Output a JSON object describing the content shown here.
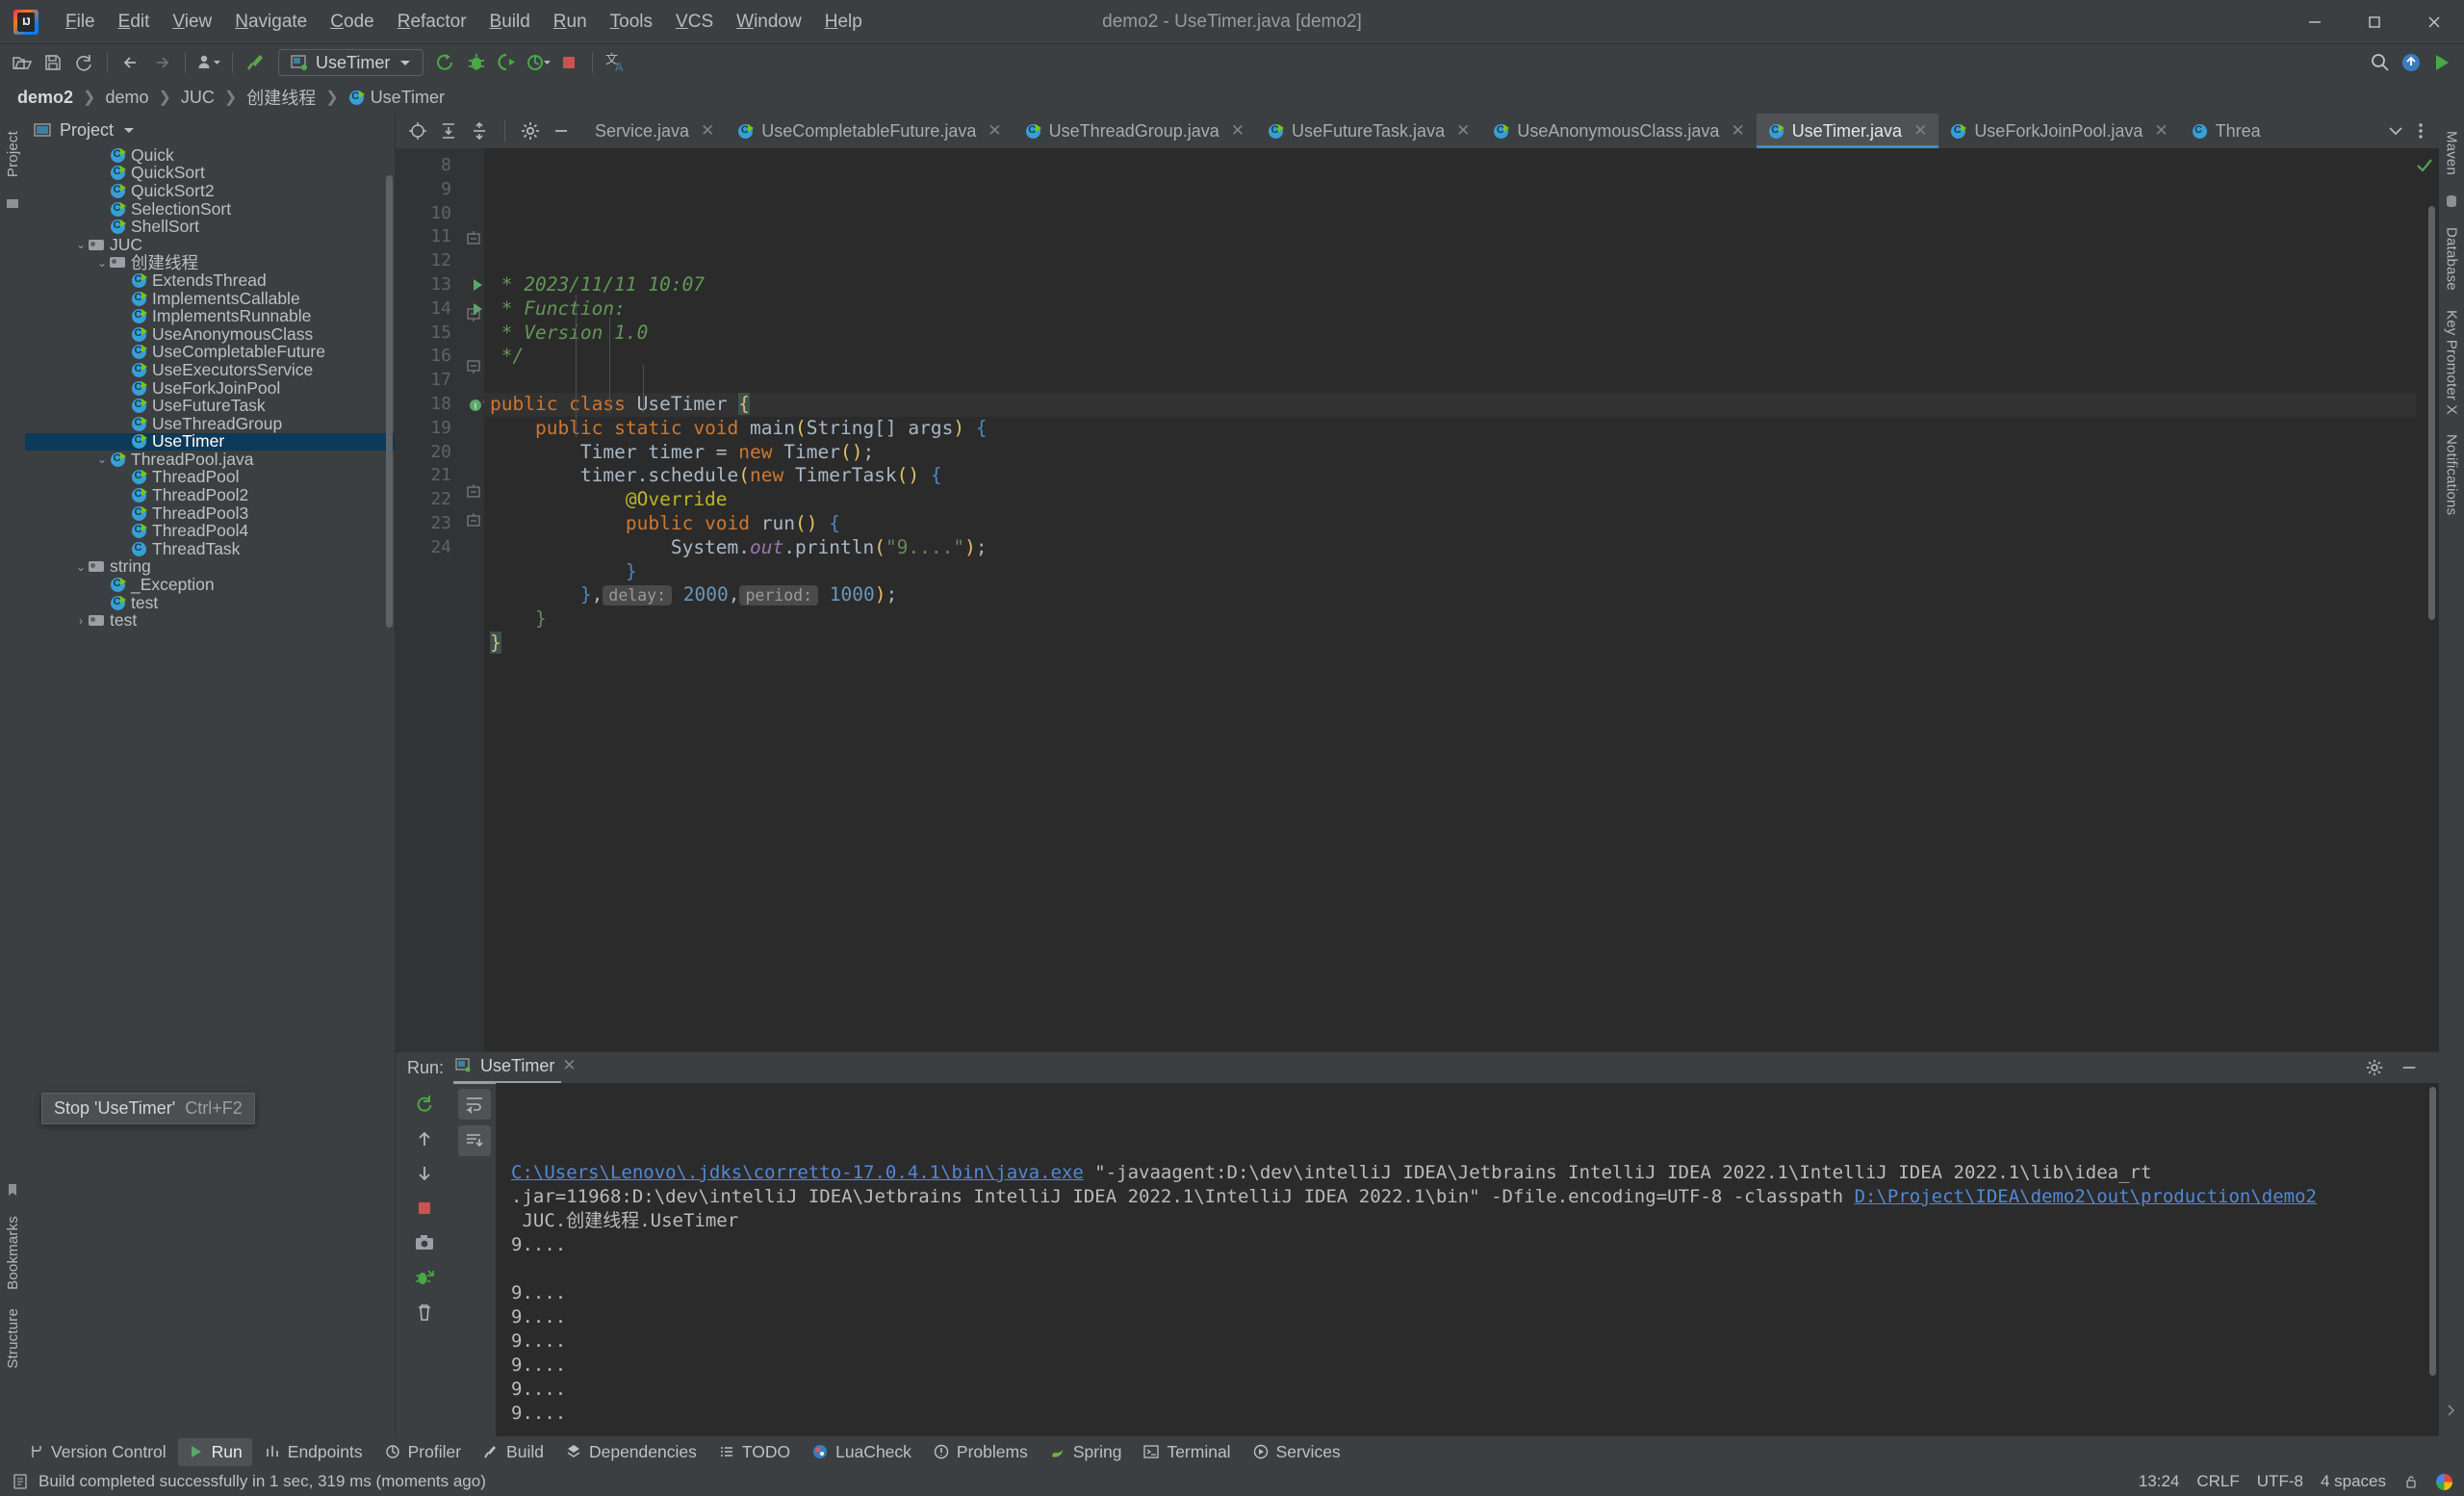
{
  "window": {
    "title": "demo2 - UseTimer.java [demo2]",
    "minimize": "—",
    "maximize": "▢",
    "close": "✕"
  },
  "menu": [
    "File",
    "Edit",
    "View",
    "Navigate",
    "Code",
    "Refactor",
    "Build",
    "Run",
    "Tools",
    "VCS",
    "Window",
    "Help"
  ],
  "toolbar": {
    "run_config": "UseTimer",
    "icons": [
      "open-folder-icon",
      "save-icon",
      "sync-icon",
      "back-arrow-icon",
      "forward-arrow-icon",
      "profile-icon",
      "build-hammer-icon",
      "run-icon",
      "debug-icon",
      "run-with-coverage-icon",
      "profile-run-icon",
      "stop-icon",
      "translate-icon",
      "search-everywhere-icon",
      "updates-icon",
      "ide-run-icon"
    ]
  },
  "breadcrumb": [
    "demo2",
    "demo",
    "JUC",
    "创建线程",
    "UseTimer"
  ],
  "left_strip": [
    "Project",
    "Bookmarks",
    "Structure"
  ],
  "right_strip": [
    "Maven",
    "Database",
    "Key Promoter X",
    "Notifications"
  ],
  "project": {
    "title": "Project",
    "tree": [
      {
        "label": "Quick",
        "indent": 3,
        "icon": "class-icon",
        "arrow": "",
        "selected": false
      },
      {
        "label": "QuickSort",
        "indent": 3,
        "icon": "class-icon",
        "arrow": "",
        "selected": false
      },
      {
        "label": "QuickSort2",
        "indent": 3,
        "icon": "class-icon",
        "arrow": "",
        "selected": false
      },
      {
        "label": "SelectionSort",
        "indent": 3,
        "icon": "class-icon",
        "arrow": "",
        "selected": false
      },
      {
        "label": "ShellSort",
        "indent": 3,
        "icon": "class-icon",
        "arrow": "",
        "selected": false
      },
      {
        "label": "JUC",
        "indent": 2,
        "icon": "folder-icon",
        "arrow": "v",
        "selected": false
      },
      {
        "label": "创建线程",
        "indent": 3,
        "icon": "folder-icon",
        "arrow": "v",
        "selected": false
      },
      {
        "label": "ExtendsThread",
        "indent": 4,
        "icon": "class-icon",
        "arrow": "",
        "selected": false
      },
      {
        "label": "ImplementsCallable",
        "indent": 4,
        "icon": "class-icon",
        "arrow": "",
        "selected": false
      },
      {
        "label": "ImplementsRunnable",
        "indent": 4,
        "icon": "class-icon",
        "arrow": "",
        "selected": false
      },
      {
        "label": "UseAnonymousClass",
        "indent": 4,
        "icon": "class-icon",
        "arrow": "",
        "selected": false
      },
      {
        "label": "UseCompletableFuture",
        "indent": 4,
        "icon": "class-icon",
        "arrow": "",
        "selected": false
      },
      {
        "label": "UseExecutorsService",
        "indent": 4,
        "icon": "class-icon",
        "arrow": "",
        "selected": false
      },
      {
        "label": "UseForkJoinPool",
        "indent": 4,
        "icon": "class-icon",
        "arrow": "",
        "selected": false
      },
      {
        "label": "UseFutureTask",
        "indent": 4,
        "icon": "class-icon",
        "arrow": "",
        "selected": false
      },
      {
        "label": "UseThreadGroup",
        "indent": 4,
        "icon": "class-icon",
        "arrow": "",
        "selected": false
      },
      {
        "label": "UseTimer",
        "indent": 4,
        "icon": "class-icon",
        "arrow": "",
        "selected": true
      },
      {
        "label": "ThreadPool.java",
        "indent": 3,
        "icon": "class-icon",
        "arrow": "v",
        "selected": false
      },
      {
        "label": "ThreadPool",
        "indent": 4,
        "icon": "class-icon",
        "arrow": "",
        "selected": false
      },
      {
        "label": "ThreadPool2",
        "indent": 4,
        "icon": "class-icon",
        "arrow": "",
        "selected": false
      },
      {
        "label": "ThreadPool3",
        "indent": 4,
        "icon": "class-icon",
        "arrow": "",
        "selected": false
      },
      {
        "label": "ThreadPool4",
        "indent": 4,
        "icon": "class-icon",
        "arrow": "",
        "selected": false
      },
      {
        "label": "ThreadTask",
        "indent": 4,
        "icon": "class-plain-icon",
        "arrow": "",
        "selected": false
      },
      {
        "label": "string",
        "indent": 2,
        "icon": "folder-icon",
        "arrow": "v",
        "selected": false
      },
      {
        "label": "_Exception",
        "indent": 3,
        "icon": "class-icon",
        "arrow": "",
        "selected": false
      },
      {
        "label": "test",
        "indent": 3,
        "icon": "class-icon",
        "arrow": "",
        "selected": false
      },
      {
        "label": "test",
        "indent": 2,
        "icon": "folder-icon",
        "arrow": ">",
        "selected": false
      }
    ]
  },
  "editor": {
    "tabs": [
      {
        "label": "Service.java",
        "icon": "",
        "active": false,
        "truncated": true
      },
      {
        "label": "UseCompletableFuture.java",
        "icon": "class-icon",
        "active": false
      },
      {
        "label": "UseThreadGroup.java",
        "icon": "class-icon",
        "active": false
      },
      {
        "label": "UseFutureTask.java",
        "icon": "class-icon",
        "active": false
      },
      {
        "label": "UseAnonymousClass.java",
        "icon": "class-icon",
        "active": false
      },
      {
        "label": "UseTimer.java",
        "icon": "class-icon",
        "active": true
      },
      {
        "label": "UseForkJoinPool.java",
        "icon": "class-icon",
        "active": false
      },
      {
        "label": "Threa",
        "icon": "class-plain-icon",
        "active": false
      }
    ],
    "first_line_number": 8,
    "lines": [
      {
        "n": 8,
        "segments": [
          {
            "t": " * 2023/11/11 10:07",
            "c": "cmt"
          }
        ]
      },
      {
        "n": 9,
        "segments": [
          {
            "t": " * Function:",
            "c": "cmt"
          }
        ]
      },
      {
        "n": 10,
        "segments": [
          {
            "t": " * Version 1.0",
            "c": "cmt"
          }
        ]
      },
      {
        "n": 11,
        "segments": [
          {
            "t": " */",
            "c": "cmt"
          }
        ],
        "fold": "end"
      },
      {
        "n": 12,
        "segments": []
      },
      {
        "n": 13,
        "segments": [
          {
            "t": "public class ",
            "c": "kw"
          },
          {
            "t": "UseTimer ",
            "c": "typ"
          },
          {
            "t": "{",
            "c": "caret"
          }
        ],
        "gutter": "run",
        "current": true
      },
      {
        "n": 14,
        "segments": [
          {
            "t": "    ",
            "c": "plain"
          },
          {
            "t": "public static void ",
            "c": "kw"
          },
          {
            "t": "main",
            "c": "typ"
          },
          {
            "t": "(",
            "c": "brk"
          },
          {
            "t": "String[] args",
            "c": "plain"
          },
          {
            "t": ")",
            "c": "brk"
          },
          {
            "t": " {",
            "c": "brk2"
          }
        ],
        "gutter": "run",
        "fold": "start"
      },
      {
        "n": 15,
        "segments": [
          {
            "t": "        Timer timer = ",
            "c": "plain"
          },
          {
            "t": "new ",
            "c": "kw"
          },
          {
            "t": "Timer",
            "c": "plain"
          },
          {
            "t": "()",
            "c": "brk"
          },
          {
            "t": ";",
            "c": "plain"
          }
        ]
      },
      {
        "n": 16,
        "segments": [
          {
            "t": "        timer.schedule",
            "c": "plain"
          },
          {
            "t": "(",
            "c": "brk"
          },
          {
            "t": "new ",
            "c": "kw"
          },
          {
            "t": "TimerTask",
            "c": "plain"
          },
          {
            "t": "()",
            "c": "brk"
          },
          {
            "t": " {",
            "c": "brk2"
          }
        ],
        "fold": "start"
      },
      {
        "n": 17,
        "segments": [
          {
            "t": "            @Override",
            "c": "ann"
          }
        ]
      },
      {
        "n": 18,
        "segments": [
          {
            "t": "            ",
            "c": "plain"
          },
          {
            "t": "public void ",
            "c": "kw"
          },
          {
            "t": "run",
            "c": "typ"
          },
          {
            "t": "()",
            "c": "brk"
          },
          {
            "t": " {",
            "c": "brk2"
          }
        ],
        "gutter": "override"
      },
      {
        "n": 19,
        "segments": [
          {
            "t": "                System.",
            "c": "plain"
          },
          {
            "t": "out",
            "c": "fld"
          },
          {
            "t": ".println",
            "c": "plain"
          },
          {
            "t": "(",
            "c": "brk"
          },
          {
            "t": "\"9....\"",
            "c": "str"
          },
          {
            "t": ")",
            "c": "brk"
          },
          {
            "t": ";",
            "c": "plain"
          }
        ]
      },
      {
        "n": 20,
        "segments": [
          {
            "t": "            }",
            "c": "brk2"
          }
        ]
      },
      {
        "n": 21,
        "segments": [
          {
            "t": "        }",
            "c": "brk2"
          },
          {
            "t": ",",
            "c": "plain"
          },
          {
            "t": "HINT:delay:",
            "c": "hint"
          },
          {
            "t": " 2000",
            "c": "num"
          },
          {
            "t": ",",
            "c": "plain"
          },
          {
            "t": "HINT:period:",
            "c": "hint"
          },
          {
            "t": " 1000",
            "c": "num"
          },
          {
            "t": ")",
            "c": "brk"
          },
          {
            "t": ";",
            "c": "plain"
          }
        ],
        "fold": "end"
      },
      {
        "n": 22,
        "segments": [
          {
            "t": "    }",
            "c": "brk3"
          }
        ],
        "fold": "end"
      },
      {
        "n": 23,
        "segments": [
          {
            "t": "}",
            "c": "caret2"
          }
        ]
      },
      {
        "n": 24,
        "segments": []
      }
    ],
    "hints": {
      "delay": "delay:",
      "period": "period:"
    }
  },
  "run_panel": {
    "label": "Run:",
    "tab": "UseTimer",
    "settings_icon": "gear-icon",
    "minimize_icon": "minimize-icon",
    "console": [
      {
        "type": "mixed",
        "parts": [
          {
            "text": "C:\\Users\\Lenovo\\.jdks\\corretto-17.0.4.1\\bin\\java.exe",
            "link": true
          },
          {
            "text": " \"-javaagent:D:\\dev\\intelliJ IDEA\\Jetbrains IntelliJ IDEA 2022.1\\IntelliJ IDEA 2022.1\\lib\\idea_rt",
            "link": false
          }
        ]
      },
      {
        "type": "mixed",
        "parts": [
          {
            "text": ".jar=11968:D:\\dev\\intelliJ IDEA\\Jetbrains IntelliJ IDEA 2022.1\\IntelliJ IDEA 2022.1\\bin\" -Dfile.encoding=UTF-8 -classpath ",
            "link": false
          },
          {
            "text": "D:\\Project\\IDEA\\demo2\\out\\production\\demo2",
            "link": true
          }
        ]
      },
      {
        "type": "plain",
        "text": " JUC.创建线程.UseTimer"
      },
      {
        "type": "plain",
        "text": "9...."
      },
      {
        "type": "plain",
        "text": ""
      },
      {
        "type": "plain",
        "text": "9...."
      },
      {
        "type": "plain",
        "text": "9...."
      },
      {
        "type": "plain",
        "text": "9...."
      },
      {
        "type": "plain",
        "text": "9...."
      },
      {
        "type": "plain",
        "text": "9...."
      },
      {
        "type": "plain",
        "text": "9...."
      }
    ],
    "tooltip": {
      "text": "Stop 'UseTimer'",
      "shortcut": "Ctrl+F2"
    }
  },
  "tool_window_bar": [
    {
      "label": "Version Control",
      "icon": "branch-icon",
      "active": false
    },
    {
      "label": "Run",
      "icon": "run-icon",
      "active": true
    },
    {
      "label": "Endpoints",
      "icon": "endpoints-icon",
      "active": false
    },
    {
      "label": "Profiler",
      "icon": "profiler-icon",
      "active": false
    },
    {
      "label": "Build",
      "icon": "hammer-icon",
      "active": false
    },
    {
      "label": "Dependencies",
      "icon": "dependencies-icon",
      "active": false
    },
    {
      "label": "TODO",
      "icon": "todo-icon",
      "active": false
    },
    {
      "label": "LuaCheck",
      "icon": "luacheck-icon",
      "active": false
    },
    {
      "label": "Problems",
      "icon": "problems-icon",
      "active": false
    },
    {
      "label": "Spring",
      "icon": "spring-icon",
      "active": false
    },
    {
      "label": "Terminal",
      "icon": "terminal-icon",
      "active": false
    },
    {
      "label": "Services",
      "icon": "services-icon",
      "active": false
    }
  ],
  "status_bar": {
    "message": "Build completed successfully in 1 sec, 319 ms (moments ago)",
    "time": "13:24",
    "line_separator": "CRLF",
    "encoding": "UTF-8",
    "indent": "4 spaces",
    "lock_icon": "lock-icon",
    "browser_icon": "chrome-icon"
  }
}
